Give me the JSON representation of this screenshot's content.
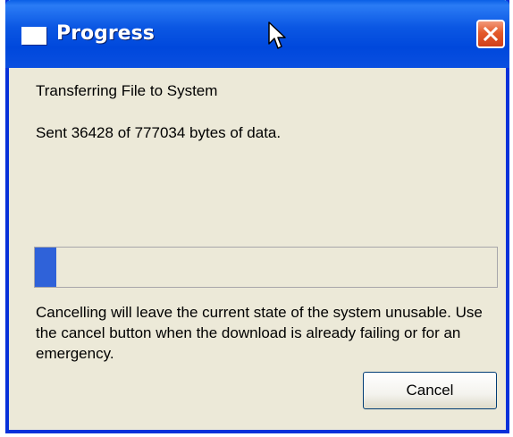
{
  "window": {
    "title": "Progress",
    "icon": "window-icon"
  },
  "titlebar": {
    "close_icon": "close-icon"
  },
  "content": {
    "status_line": "Transferring File to System",
    "bytes_line": "Sent 36428 of 777034 bytes of data.",
    "progress_fraction": 0.047,
    "warning": "Cancelling will leave the current state of the system unusable. Use the cancel button when the download is already failing or for an emergency."
  },
  "buttons": {
    "cancel_label": "Cancel"
  },
  "colors": {
    "titlebar": "#0048dc",
    "dialog_bg": "#ece9d8",
    "close_btn": "#e45a2a",
    "progress_fill": "#2f62d9"
  }
}
